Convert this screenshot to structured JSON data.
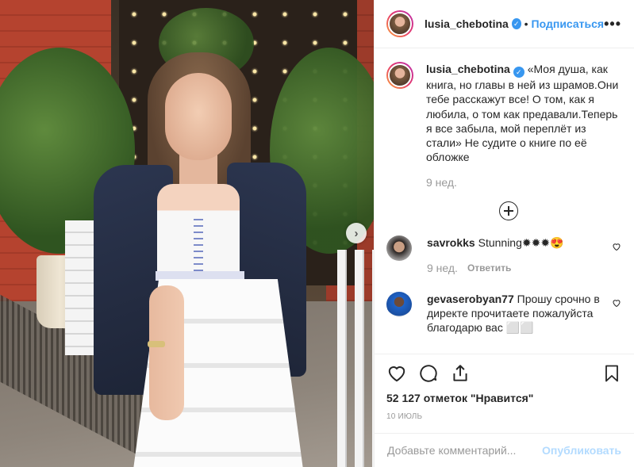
{
  "post": {
    "username": "lusia_chebotina",
    "verified_icon": "verified-check-icon",
    "dot": "•",
    "follow_label": "Подписаться",
    "more_label": "•••"
  },
  "caption": {
    "username": "lusia_chebotina",
    "text": "«Моя душа, как книга, но главы в ней из шрамов.Они тебе расскажут все! О том, как я любила, о том как предавали.Теперь я все забыла, мой переплёт из стали» Не судите о книге по её обложке",
    "time": "9 нед."
  },
  "comments": [
    {
      "username": "savrokks",
      "text": "Stunning✹✹✹😍",
      "time": "9 нед.",
      "reply_label": "Ответить"
    },
    {
      "username": "gevaserobyan77",
      "text": "Прошу срочно в директе прочитаете пожалуйста благодарю вас ⬜⬜"
    }
  ],
  "actions": {
    "likes": "52 127 отметок \"Нравится\"",
    "date": "10 июль"
  },
  "add_comment": {
    "placeholder": "Добавьте комментарий...",
    "publish_label": "Опубликовать"
  },
  "colors": {
    "accent": "#3897f0",
    "text": "#262626",
    "muted": "#999999",
    "publish_disabled": "#b3dbff",
    "border": "#efefef"
  }
}
